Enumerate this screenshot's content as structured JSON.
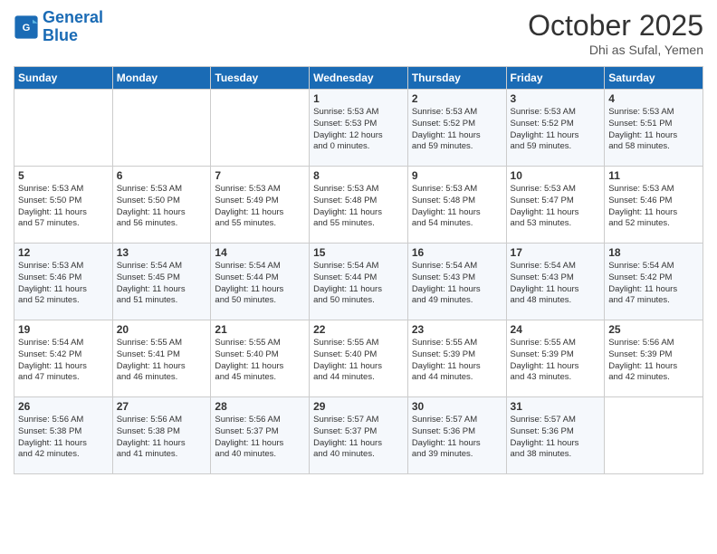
{
  "header": {
    "logo_line1": "General",
    "logo_line2": "Blue",
    "month": "October 2025",
    "location": "Dhi as Sufal, Yemen"
  },
  "days_of_week": [
    "Sunday",
    "Monday",
    "Tuesday",
    "Wednesday",
    "Thursday",
    "Friday",
    "Saturday"
  ],
  "weeks": [
    [
      {
        "day": "",
        "info": ""
      },
      {
        "day": "",
        "info": ""
      },
      {
        "day": "",
        "info": ""
      },
      {
        "day": "1",
        "info": "Sunrise: 5:53 AM\nSunset: 5:53 PM\nDaylight: 12 hours\nand 0 minutes."
      },
      {
        "day": "2",
        "info": "Sunrise: 5:53 AM\nSunset: 5:52 PM\nDaylight: 11 hours\nand 59 minutes."
      },
      {
        "day": "3",
        "info": "Sunrise: 5:53 AM\nSunset: 5:52 PM\nDaylight: 11 hours\nand 59 minutes."
      },
      {
        "day": "4",
        "info": "Sunrise: 5:53 AM\nSunset: 5:51 PM\nDaylight: 11 hours\nand 58 minutes."
      }
    ],
    [
      {
        "day": "5",
        "info": "Sunrise: 5:53 AM\nSunset: 5:50 PM\nDaylight: 11 hours\nand 57 minutes."
      },
      {
        "day": "6",
        "info": "Sunrise: 5:53 AM\nSunset: 5:50 PM\nDaylight: 11 hours\nand 56 minutes."
      },
      {
        "day": "7",
        "info": "Sunrise: 5:53 AM\nSunset: 5:49 PM\nDaylight: 11 hours\nand 55 minutes."
      },
      {
        "day": "8",
        "info": "Sunrise: 5:53 AM\nSunset: 5:48 PM\nDaylight: 11 hours\nand 55 minutes."
      },
      {
        "day": "9",
        "info": "Sunrise: 5:53 AM\nSunset: 5:48 PM\nDaylight: 11 hours\nand 54 minutes."
      },
      {
        "day": "10",
        "info": "Sunrise: 5:53 AM\nSunset: 5:47 PM\nDaylight: 11 hours\nand 53 minutes."
      },
      {
        "day": "11",
        "info": "Sunrise: 5:53 AM\nSunset: 5:46 PM\nDaylight: 11 hours\nand 52 minutes."
      }
    ],
    [
      {
        "day": "12",
        "info": "Sunrise: 5:53 AM\nSunset: 5:46 PM\nDaylight: 11 hours\nand 52 minutes."
      },
      {
        "day": "13",
        "info": "Sunrise: 5:54 AM\nSunset: 5:45 PM\nDaylight: 11 hours\nand 51 minutes."
      },
      {
        "day": "14",
        "info": "Sunrise: 5:54 AM\nSunset: 5:44 PM\nDaylight: 11 hours\nand 50 minutes."
      },
      {
        "day": "15",
        "info": "Sunrise: 5:54 AM\nSunset: 5:44 PM\nDaylight: 11 hours\nand 50 minutes."
      },
      {
        "day": "16",
        "info": "Sunrise: 5:54 AM\nSunset: 5:43 PM\nDaylight: 11 hours\nand 49 minutes."
      },
      {
        "day": "17",
        "info": "Sunrise: 5:54 AM\nSunset: 5:43 PM\nDaylight: 11 hours\nand 48 minutes."
      },
      {
        "day": "18",
        "info": "Sunrise: 5:54 AM\nSunset: 5:42 PM\nDaylight: 11 hours\nand 47 minutes."
      }
    ],
    [
      {
        "day": "19",
        "info": "Sunrise: 5:54 AM\nSunset: 5:42 PM\nDaylight: 11 hours\nand 47 minutes."
      },
      {
        "day": "20",
        "info": "Sunrise: 5:55 AM\nSunset: 5:41 PM\nDaylight: 11 hours\nand 46 minutes."
      },
      {
        "day": "21",
        "info": "Sunrise: 5:55 AM\nSunset: 5:40 PM\nDaylight: 11 hours\nand 45 minutes."
      },
      {
        "day": "22",
        "info": "Sunrise: 5:55 AM\nSunset: 5:40 PM\nDaylight: 11 hours\nand 44 minutes."
      },
      {
        "day": "23",
        "info": "Sunrise: 5:55 AM\nSunset: 5:39 PM\nDaylight: 11 hours\nand 44 minutes."
      },
      {
        "day": "24",
        "info": "Sunrise: 5:55 AM\nSunset: 5:39 PM\nDaylight: 11 hours\nand 43 minutes."
      },
      {
        "day": "25",
        "info": "Sunrise: 5:56 AM\nSunset: 5:39 PM\nDaylight: 11 hours\nand 42 minutes."
      }
    ],
    [
      {
        "day": "26",
        "info": "Sunrise: 5:56 AM\nSunset: 5:38 PM\nDaylight: 11 hours\nand 42 minutes."
      },
      {
        "day": "27",
        "info": "Sunrise: 5:56 AM\nSunset: 5:38 PM\nDaylight: 11 hours\nand 41 minutes."
      },
      {
        "day": "28",
        "info": "Sunrise: 5:56 AM\nSunset: 5:37 PM\nDaylight: 11 hours\nand 40 minutes."
      },
      {
        "day": "29",
        "info": "Sunrise: 5:57 AM\nSunset: 5:37 PM\nDaylight: 11 hours\nand 40 minutes."
      },
      {
        "day": "30",
        "info": "Sunrise: 5:57 AM\nSunset: 5:36 PM\nDaylight: 11 hours\nand 39 minutes."
      },
      {
        "day": "31",
        "info": "Sunrise: 5:57 AM\nSunset: 5:36 PM\nDaylight: 11 hours\nand 38 minutes."
      },
      {
        "day": "",
        "info": ""
      }
    ]
  ]
}
